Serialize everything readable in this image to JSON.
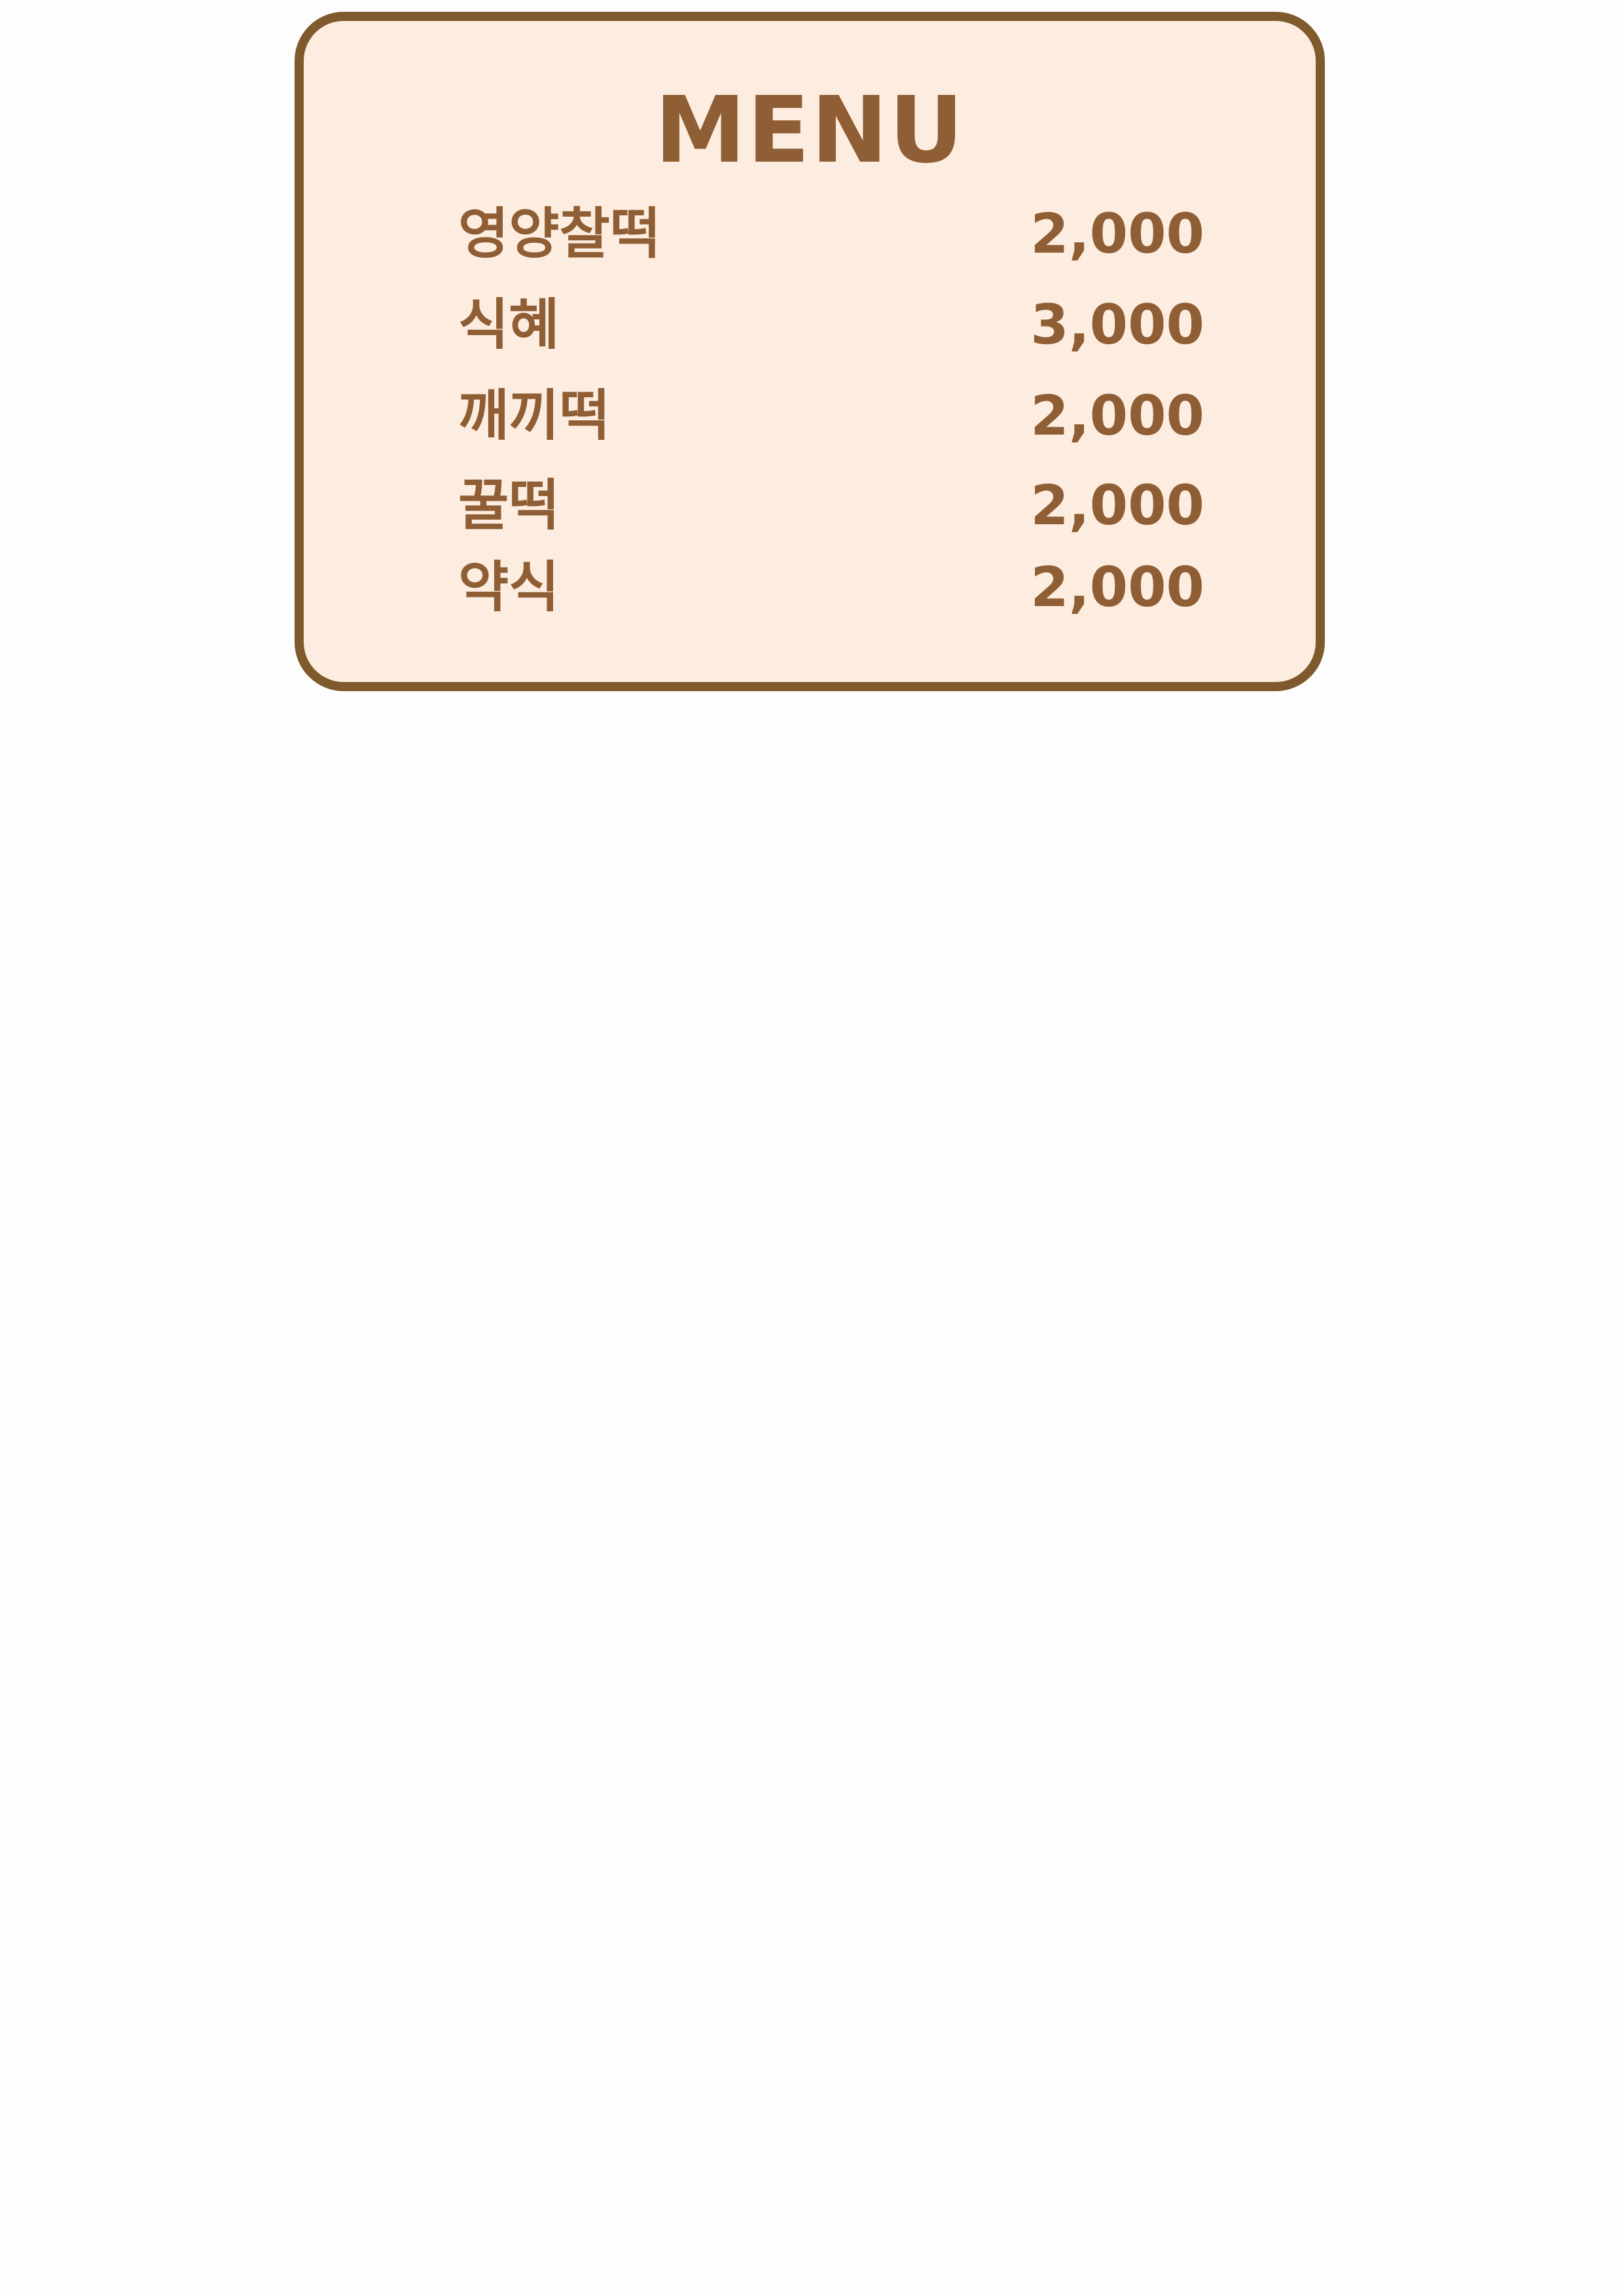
{
  "menu": {
    "title": "MENU",
    "items": [
      {
        "name": "영양찰떡",
        "price": "2,000"
      },
      {
        "name": "식혜",
        "price": "3,000"
      },
      {
        "name": "깨끼떡",
        "price": "2,000"
      },
      {
        "name": "꿀떡",
        "price": "2,000"
      },
      {
        "name": "약식",
        "price": "2,000"
      }
    ]
  },
  "colors": {
    "accent": "#8f5e34",
    "border": "#7f5a2c",
    "card_background": "#fcede0",
    "page_background": "#fefdfd"
  }
}
